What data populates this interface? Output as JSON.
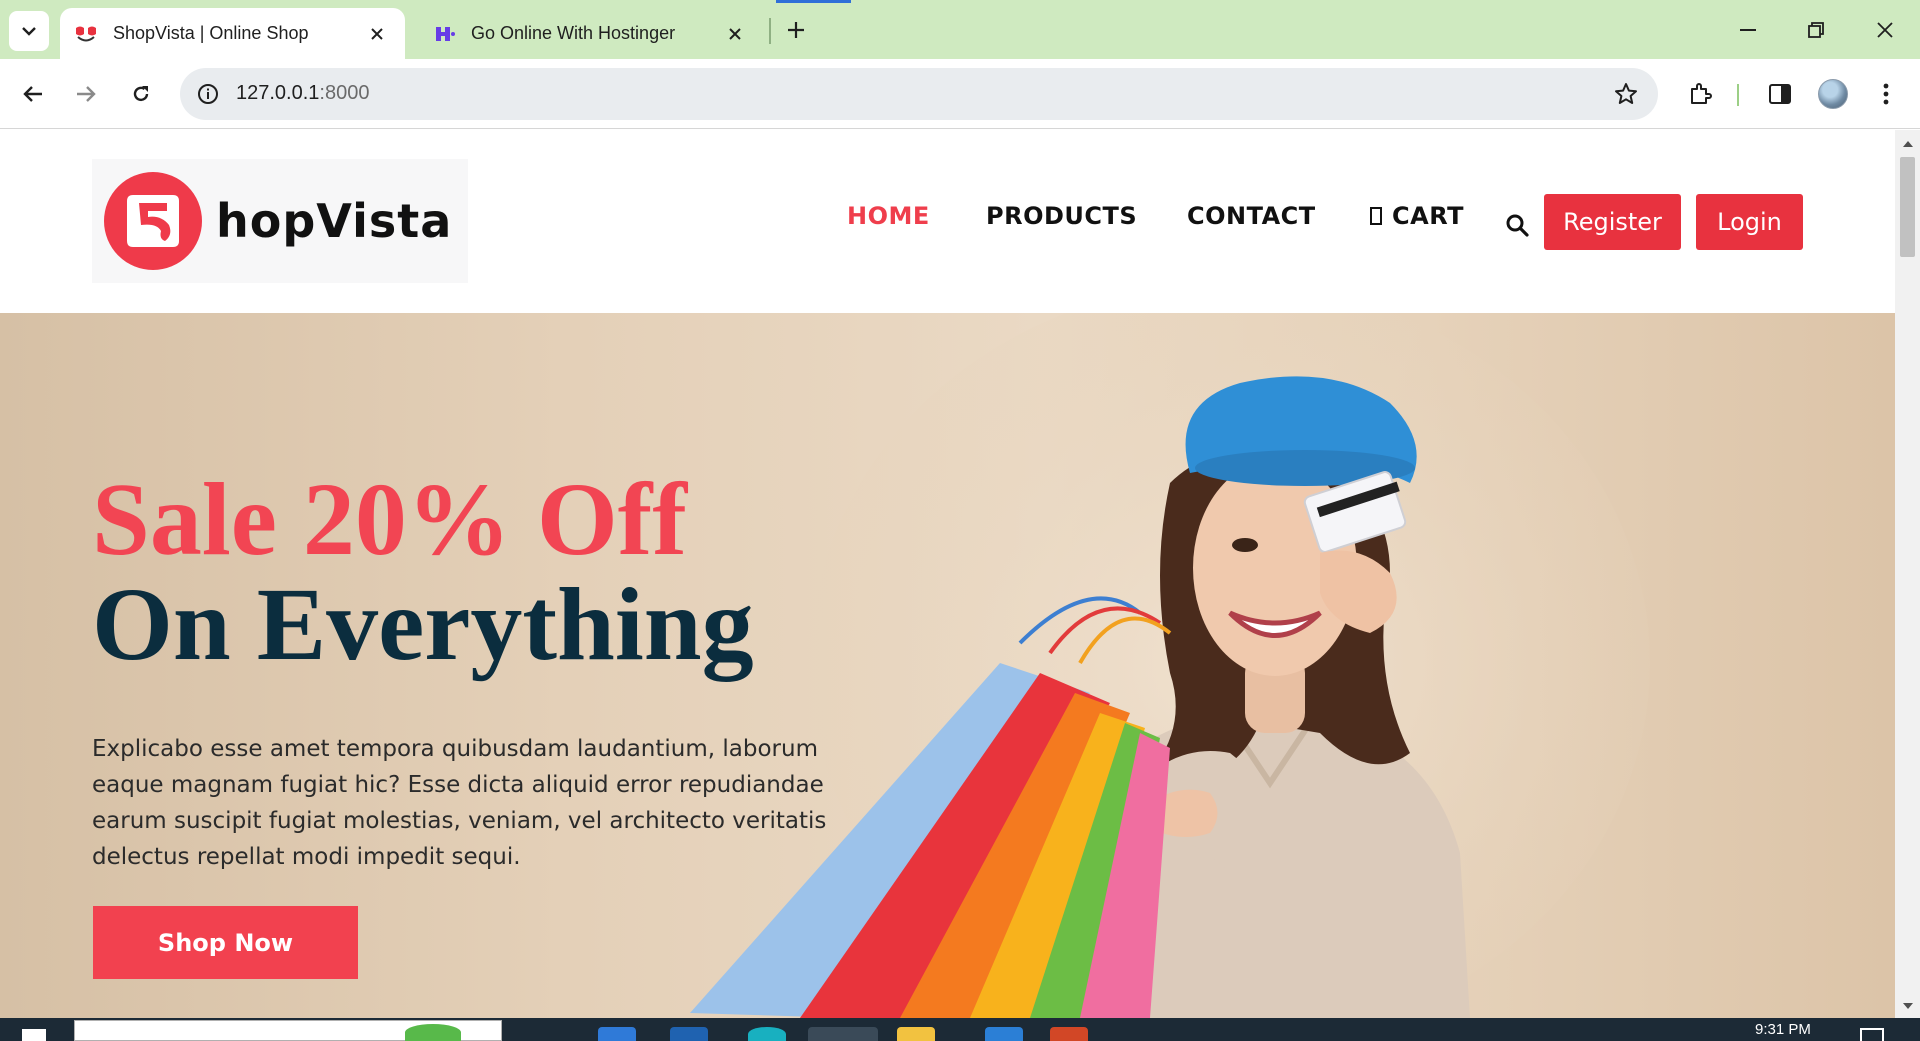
{
  "browser": {
    "tabs": [
      {
        "title": "ShopVista | Online Shop",
        "active": true
      },
      {
        "title": "Go Online With Hostinger",
        "active": false
      }
    ],
    "address": {
      "host": "127.0.0.1",
      "port": ":8000"
    }
  },
  "site": {
    "logo_text": "hopVista",
    "nav": {
      "home": "HOME",
      "products": "PRODUCTS",
      "contact": "CONTACT",
      "cart": "CART"
    },
    "register_label": "Register",
    "login_label": "Login"
  },
  "hero": {
    "title_line1": "Sale 20% Off",
    "title_line2": "On Everything",
    "description": "Explicabo esse amet tempora quibusdam laudantium, laborum eaque magnam fugiat hic? Esse dicta aliquid error repudiandae earum suscipit fugiat molestias, veniam, vel architecto veritatis delectus repellat modi impedit sequi.",
    "cta_label": "Shop Now"
  },
  "taskbar": {
    "clock": "9:31 PM"
  },
  "colors": {
    "accent_red": "#e8323f",
    "hero_title_red": "#f24553",
    "hero_title_navy": "#0b2d3e",
    "chrome_green": "#cfeac0"
  },
  "icons": [
    "tab-search-icon",
    "favicon-shopvista",
    "favicon-hostinger",
    "close-icon",
    "plus-icon",
    "minimize-icon",
    "restore-icon",
    "window-close-icon",
    "back-icon",
    "forward-icon",
    "reload-icon",
    "info-icon",
    "star-icon",
    "extensions-icon",
    "side-panel-icon",
    "profile-avatar",
    "menu-icon",
    "search-icon",
    "cart-icon"
  ]
}
